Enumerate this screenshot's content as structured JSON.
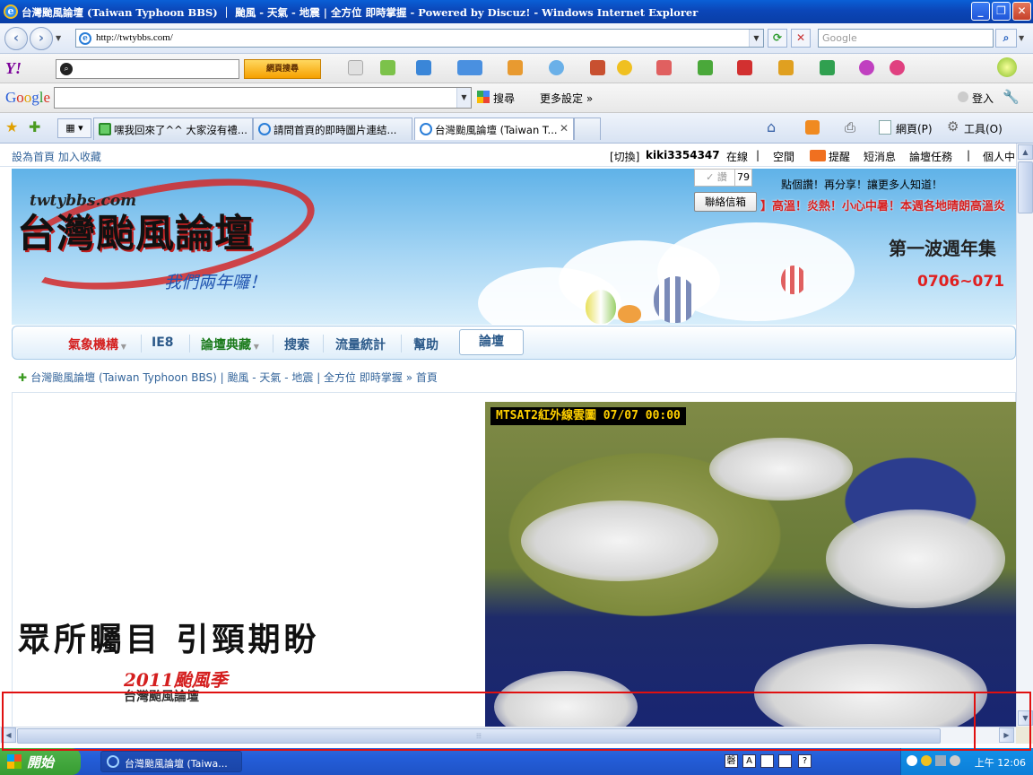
{
  "window": {
    "title": "台灣颱風論壇 (Taiwan Typhoon BBS) ｜ 颱風 - 天氣 - 地震 | 全方位 即時掌握 - Powered by Discuz! - Windows Internet Explorer",
    "app_icon": "e",
    "minimize": "_",
    "maximize": "❐",
    "close": "✕"
  },
  "address_bar": {
    "url": "http://twtybbs.com/",
    "search_placeholder": "Google"
  },
  "yahoo_toolbar": {
    "logo": "Y!",
    "search_button": "網頁搜尋"
  },
  "google_toolbar": {
    "logo": "Google",
    "search_label": "搜尋",
    "more_settings": "更多設定 »",
    "sign_in": "登入"
  },
  "tabs": [
    {
      "label": "嘿我回來了^^ 大家沒有禮..."
    },
    {
      "label": "請問首頁的即時圖片連結..."
    },
    {
      "label": "台灣颱風論壇 (Taiwan T..."
    }
  ],
  "command_bar": {
    "page": "網頁(P)",
    "tools": "工具(O)"
  },
  "site_top": {
    "set_home": "設為首頁",
    "bookmark": "加入收藏",
    "switch": "[切換]",
    "username": "kiki3354347",
    "online": "在線",
    "space": "空間",
    "remind": "提醒",
    "messages": "短消息",
    "tasks": "論壇任務",
    "personal": "個人中"
  },
  "banner": {
    "logo_en": "twtybbs.com",
    "logo_cn": "台灣颱風論壇",
    "slogan": "我們兩年囉！",
    "like_label": "✓ 讚",
    "like_count": "79",
    "share_text": "點個讚！再分享！讓更多人知道！",
    "contact_button": "聯絡信箱",
    "marquee": "】高溫！炎熱！小心中暑！本週各地晴朗高溫炎",
    "promo_title": "第一波週年集",
    "promo_date": "0706~071"
  },
  "nav": {
    "items": [
      {
        "label": "氣象機構"
      },
      {
        "label": "IE8"
      },
      {
        "label": "論壇典藏"
      },
      {
        "label": "搜索"
      },
      {
        "label": "流量統計"
      },
      {
        "label": "幫助"
      }
    ],
    "forum": "論壇"
  },
  "breadcrumb": {
    "site": "台灣颱風論壇 (Taiwan Typhoon BBS) | 颱風 - 天氣 - 地震 | 全方位 即時掌握",
    "sep": "»",
    "home": "首頁"
  },
  "content": {
    "callout": "眾所矚目 引頸期盼",
    "season": "2011颱風季",
    "season_by": "台灣颱風論壇",
    "satellite_label": "MTSAT2紅外線雲圖   07/07  00:00"
  },
  "taskbar": {
    "start": "開始",
    "window_button": "台灣颱風論壇 (Taiwa...",
    "ime": [
      "磬",
      "A"
    ],
    "clock": "上午 12:06"
  },
  "colors": {
    "accent": "#0a46b8",
    "nav_red": "#d42020",
    "nav_green": "#1a7a1a",
    "highlight": "#e01010"
  }
}
